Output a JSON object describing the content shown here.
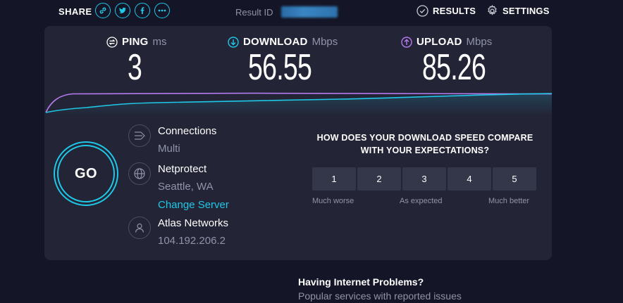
{
  "header": {
    "share_label": "SHARE",
    "share_icons": [
      "link-icon",
      "twitter-icon",
      "facebook-icon",
      "more-icon"
    ],
    "result_id_label": "Result ID",
    "result_id_value": "",
    "results_label": "RESULTS",
    "settings_label": "SETTINGS"
  },
  "metrics": {
    "ping": {
      "name": "PING",
      "unit": "ms",
      "value": "3"
    },
    "download": {
      "name": "DOWNLOAD",
      "unit": "Mbps",
      "value": "56.55"
    },
    "upload": {
      "name": "UPLOAD",
      "unit": "Mbps",
      "value": "85.26"
    }
  },
  "go_label": "GO",
  "server": {
    "connections_label": "Connections",
    "connections_value": "Multi",
    "host_name": "Netprotect",
    "host_location": "Seattle, WA",
    "change_server_label": "Change Server",
    "isp_name": "Atlas Networks",
    "ip_address": "104.192.206.2"
  },
  "survey": {
    "question_line1": "HOW DOES YOUR DOWNLOAD SPEED COMPARE",
    "question_line2": "WITH YOUR EXPECTATIONS?",
    "options": [
      "1",
      "2",
      "3",
      "4",
      "5"
    ],
    "label_low": "Much worse",
    "label_mid": "As expected",
    "label_high": "Much better"
  },
  "problems": {
    "title": "Having Internet Problems?",
    "subtitle": "Popular services with reported issues"
  },
  "colors": {
    "accent": "#1ec8e6",
    "upload": "#b57bee",
    "background": "#141526",
    "card": "#232436"
  }
}
